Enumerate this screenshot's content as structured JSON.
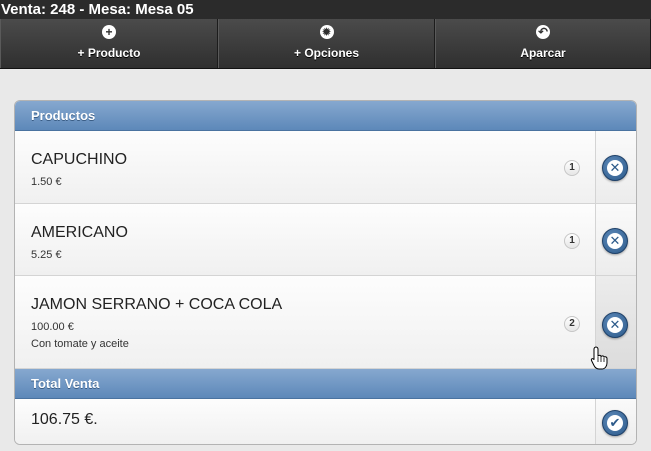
{
  "header": {
    "title": "Venta: 248 - Mesa: Mesa 05"
  },
  "nav": {
    "items": [
      {
        "label": "+ Producto",
        "icon": "plus-icon",
        "glyph": "+"
      },
      {
        "label": "+ Opciones",
        "icon": "gear-icon",
        "glyph": "✹"
      },
      {
        "label": "Aparcar",
        "icon": "undo-icon",
        "glyph": "↶"
      }
    ]
  },
  "products": {
    "title": "Productos",
    "items": [
      {
        "name": "CAPUCHINO",
        "price": "1.50 €",
        "note": "",
        "qty": "1"
      },
      {
        "name": "AMERICANO",
        "price": "5.25 €",
        "note": "",
        "qty": "1"
      },
      {
        "name": "JAMON SERRANO + COCA COLA",
        "price": "100.00 €",
        "note": "Con tomate y aceite",
        "qty": "2"
      }
    ]
  },
  "total": {
    "title": "Total Venta",
    "value": "106.75 €."
  },
  "icons": {
    "remove": "close-icon",
    "confirm": "check-icon",
    "remove_glyph": "✕",
    "confirm_glyph": "✔"
  },
  "colors": {
    "accent": "#5d88b9",
    "header_bg": "#2b2b2b",
    "round_button": "#2c5a8a"
  }
}
